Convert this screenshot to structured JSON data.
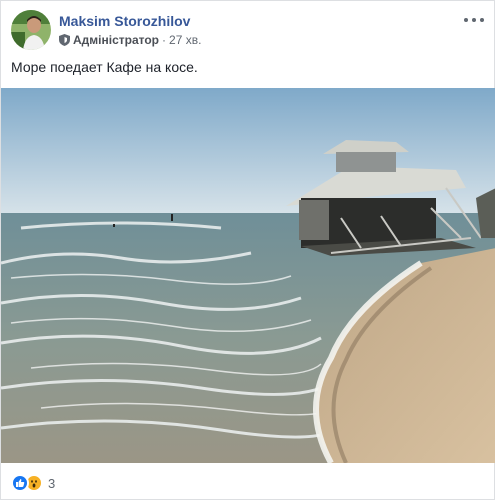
{
  "post": {
    "author": "Maksim Storozhilov",
    "role": "Адміністратор",
    "separator": "·",
    "time": "27 хв.",
    "text": "Море поедает Кафе на косе.",
    "reactions": {
      "icons": [
        "like-icon",
        "wow-icon"
      ],
      "count": "3"
    }
  },
  "colors": {
    "author_link": "#385898",
    "like": "#1877f2",
    "wow": "#f7b125",
    "meta_text": "#606770"
  }
}
